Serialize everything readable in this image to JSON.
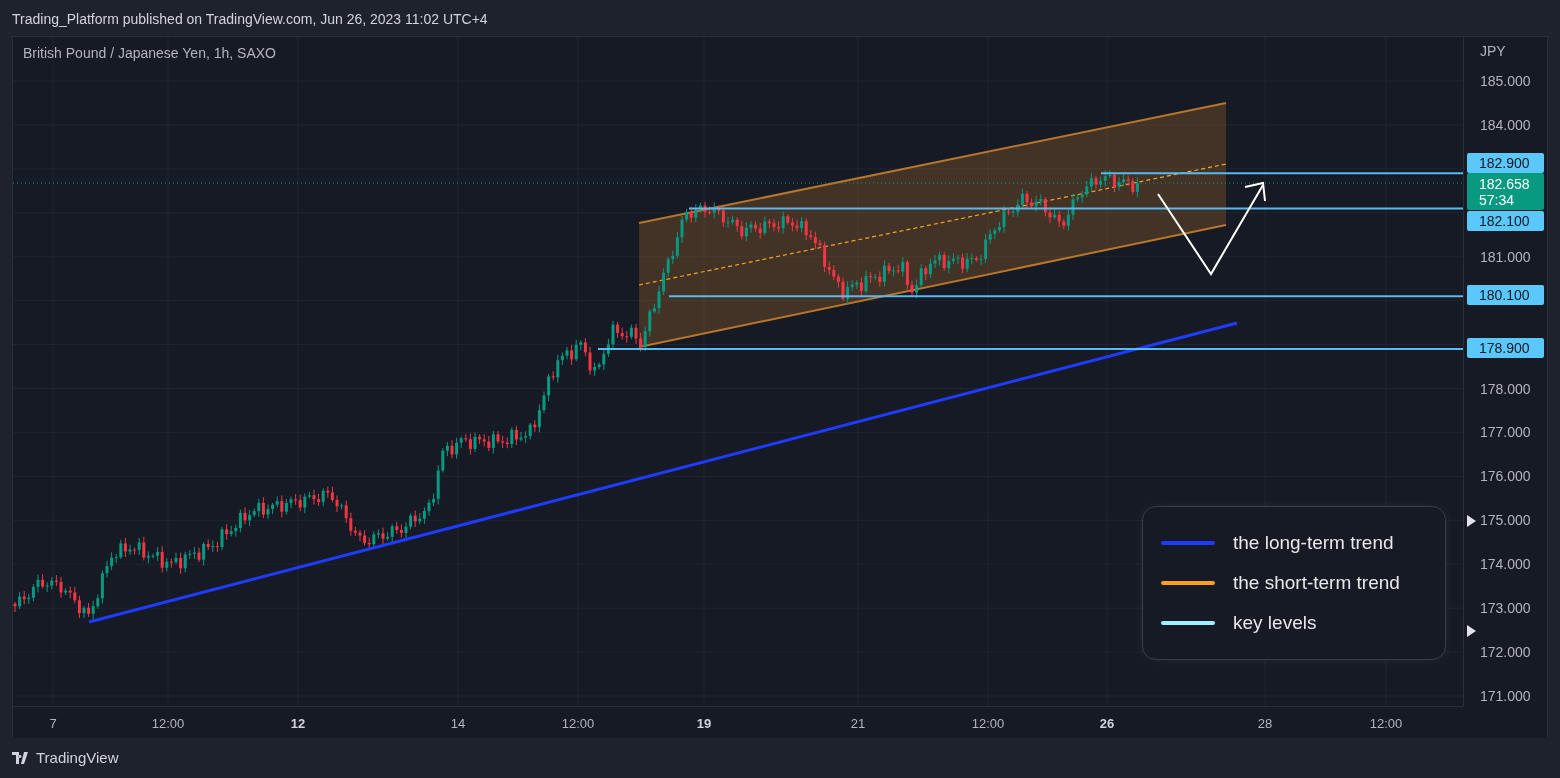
{
  "header": {
    "text": "Trading_Platform published on TradingView.com, Jun 26, 2023 11:02 UTC+4"
  },
  "chart": {
    "title": "British Pound / Japanese Yen, 1h, SAXO",
    "currency": "JPY",
    "price_ticks": [
      "185.000",
      "184.000",
      "181.000",
      "178.000",
      "177.000",
      "176.000",
      "175.000",
      "174.000",
      "173.000",
      "172.000",
      "171.000"
    ],
    "price_tags": [
      {
        "kind": "level",
        "value": "182.900"
      },
      {
        "kind": "last",
        "value": "182.658",
        "countdown": "57:34"
      },
      {
        "kind": "level",
        "value": "182.100"
      },
      {
        "kind": "level",
        "value": "180.100"
      },
      {
        "kind": "level",
        "value": "178.900"
      }
    ],
    "time_ticks": [
      {
        "label": "7",
        "major": false
      },
      {
        "label": "12:00",
        "major": false
      },
      {
        "label": "12",
        "major": true
      },
      {
        "label": "14",
        "major": false
      },
      {
        "label": "12:00",
        "major": false
      },
      {
        "label": "19",
        "major": true
      },
      {
        "label": "21",
        "major": false
      },
      {
        "label": "12:00",
        "major": false
      },
      {
        "label": "26",
        "major": true
      },
      {
        "label": "28",
        "major": false
      },
      {
        "label": "12:00",
        "major": false
      }
    ],
    "legend": [
      {
        "label": "the long-term trend",
        "color": "#1e3cff"
      },
      {
        "label": "the short-term trend",
        "color": "#ff9f1c"
      },
      {
        "label": "key levels",
        "color": "#9eeeff"
      }
    ]
  },
  "footer": {
    "brand": "TradingView"
  }
}
